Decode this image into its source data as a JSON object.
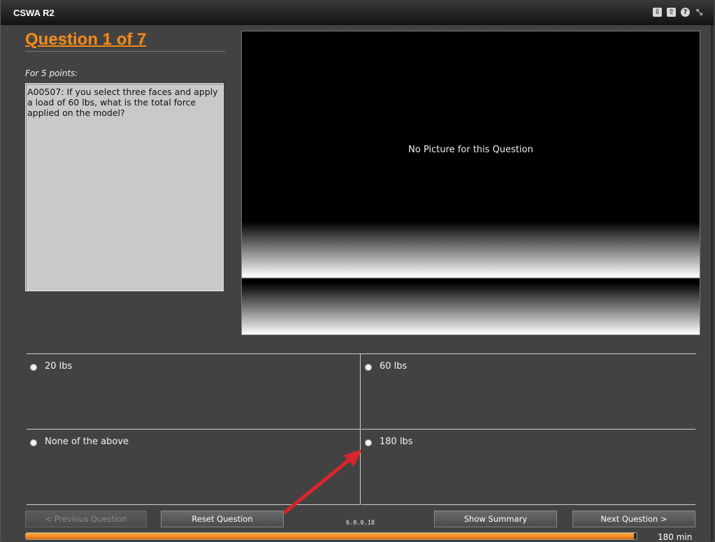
{
  "window": {
    "title": "CSWA R2"
  },
  "titlebar_icons": [
    "save-icon",
    "upload-icon",
    "help-icon",
    "minimize-icon"
  ],
  "question": {
    "heading": "Question 1 of 7",
    "points": "For 5 points:",
    "text": "A00507:  If you select three faces and apply a load of 60 lbs, what is the total force applied on the model?"
  },
  "picture": {
    "message": "No Picture for this Question"
  },
  "answers": [
    {
      "label": "20 lbs"
    },
    {
      "label": "60 lbs"
    },
    {
      "label": "None of the above"
    },
    {
      "label": "180 lbs"
    }
  ],
  "buttons": {
    "previous": "< Previous Question",
    "reset": "Reset Question",
    "summary": "Show Summary",
    "next": "Next Question >"
  },
  "version": "6.0.0.18",
  "progress": {
    "fraction": 0.995,
    "time_label": "180 min"
  },
  "colors": {
    "accent": "#f28a1a",
    "arrow": "#d9262b"
  }
}
